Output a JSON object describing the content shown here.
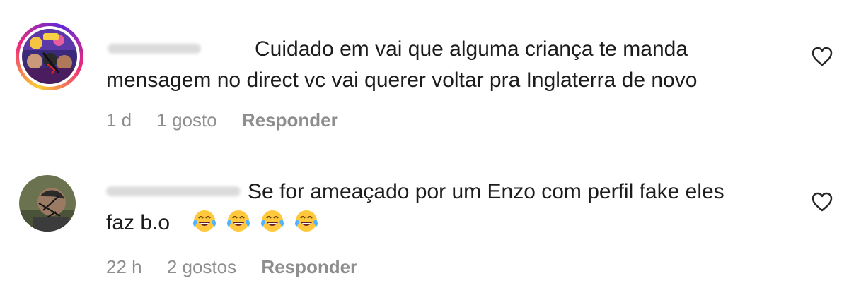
{
  "comments": [
    {
      "text_line1": "Cuidado em vai que alguma criança te manda",
      "text_line2": "mensagem no direct vc vai querer voltar pra Inglaterra de novo",
      "time": "1 d",
      "likes": "1 gosto",
      "reply": "Responder",
      "has_story_ring": true,
      "like_icon": "heart-outline-icon"
    },
    {
      "text_line1": "Se for ameaçado por um Enzo com perfil fake eles",
      "text_line2": "faz b.o",
      "emojis": [
        "face-with-tears-of-joy",
        "face-with-tears-of-joy",
        "face-with-tears-of-joy",
        "face-with-tears-of-joy"
      ],
      "time": "22 h",
      "likes": "2 gostos",
      "reply": "Responder",
      "has_story_ring": false,
      "like_icon": "heart-outline-icon"
    }
  ],
  "colors": {
    "text": "#1c1c1c",
    "meta": "#8e8e8e",
    "ring_start": "#f9ce34",
    "ring_mid": "#ee2a7b",
    "ring_end": "#6228d7"
  }
}
